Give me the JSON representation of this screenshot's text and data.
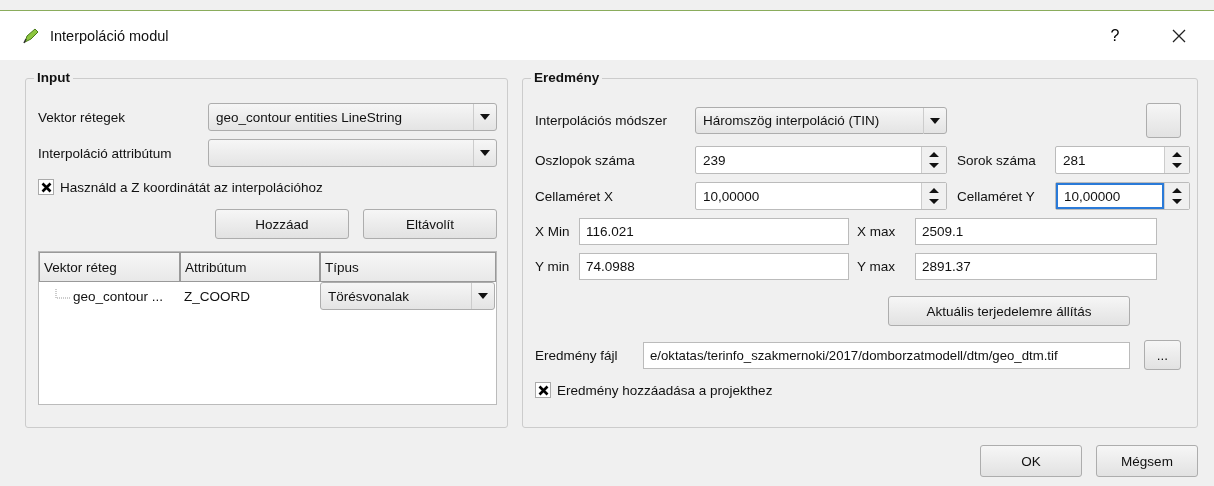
{
  "window": {
    "title": "Interpoláció modul",
    "help": "?"
  },
  "input": {
    "title": "Input",
    "vector_layers": {
      "label": "Vektor rétegek",
      "value": "geo_contour entities LineString"
    },
    "attribute": {
      "label": "Interpoláció attribútum"
    },
    "use_z": {
      "label": "Használd a Z koordinátát az interpolációhoz",
      "checked": true
    },
    "buttons": [
      "Hozzáad",
      "Eltávolít"
    ],
    "table": {
      "columns": [
        "Vektor réteg",
        "Attribútum",
        "Típus"
      ],
      "rows": [
        {
          "layer": "geo_contour ...",
          "attribute": "Z_COORD",
          "type": "Törésvonalak"
        }
      ]
    }
  },
  "output": {
    "title": "Eredmény",
    "method": {
      "label": "Interpolációs módszer",
      "value": "Háromszög interpoláció (TIN)"
    },
    "spins": [
      {
        "label": "Oszlopok száma",
        "value": "239",
        "focused": false
      },
      {
        "label": "Sorok száma",
        "value": "281",
        "focused": false
      },
      {
        "label": "Cellaméret X",
        "value": "10,00000",
        "focused": false
      },
      {
        "label": "Cellaméret Y",
        "value": "10,00000",
        "focused": true
      }
    ],
    "extent": [
      {
        "label": "X Min",
        "value": "116.021"
      },
      {
        "label": "X max",
        "value": "2509.1"
      },
      {
        "label": "Y min",
        "value": "74.0988"
      },
      {
        "label": "Y max",
        "value": "2891.37"
      }
    ],
    "extent_button": "Aktuális terjedelemre állítás",
    "file": {
      "label": "Eredmény fájl",
      "value": "e/oktatas/terinfo_szakmernoki/2017/domborzatmodell/dtm/geo_dtm.tif",
      "browse": "..."
    },
    "add_to_project": {
      "label": "Eredmény hozzáadása a projekthez",
      "checked": true
    }
  },
  "buttons": [
    "OK",
    "Mégsem"
  ]
}
